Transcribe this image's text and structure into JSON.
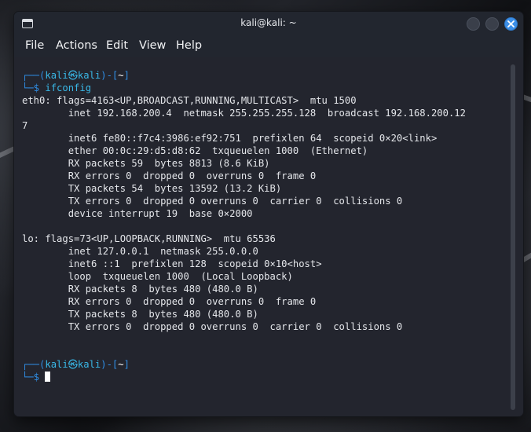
{
  "window": {
    "title": "kali@kali: ~"
  },
  "menu": {
    "items": [
      "File",
      "Actions",
      "Edit",
      "View",
      "Help"
    ]
  },
  "icons": {
    "app": "terminal-icon",
    "minimize": "minimize-icon",
    "maximize": "maximize-icon",
    "close": "close-icon"
  },
  "colors": {
    "prompt_frame": "#2f8de4",
    "prompt_user": "#39b7e6",
    "close_button": "#3c8fe8",
    "background": "#23252e"
  },
  "prompt": {
    "frame_open": "┌──(",
    "user": "kali㉿kali",
    "frame_mid": ")-[",
    "dir": "~",
    "frame_close": "]",
    "second_line": "└─$ "
  },
  "commands": {
    "first": "ifconfig"
  },
  "output": [
    "eth0: flags=4163<UP,BROADCAST,RUNNING,MULTICAST>  mtu 1500",
    "        inet 192.168.200.4  netmask 255.255.255.128  broadcast 192.168.200.12",
    "7",
    "        inet6 fe80::f7c4:3986:ef92:751  prefixlen 64  scopeid 0×20<link>",
    "        ether 00:0c:29:d5:d8:62  txqueuelen 1000  (Ethernet)",
    "        RX packets 59  bytes 8813 (8.6 KiB)",
    "        RX errors 0  dropped 0  overruns 0  frame 0",
    "        TX packets 54  bytes 13592 (13.2 KiB)",
    "        TX errors 0  dropped 0 overruns 0  carrier 0  collisions 0",
    "        device interrupt 19  base 0×2000",
    "",
    "lo: flags=73<UP,LOOPBACK,RUNNING>  mtu 65536",
    "        inet 127.0.0.1  netmask 255.0.0.0",
    "        inet6 ::1  prefixlen 128  scopeid 0×10<host>",
    "        loop  txqueuelen 1000  (Local Loopback)",
    "        RX packets 8  bytes 480 (480.0 B)",
    "        RX errors 0  dropped 0  overruns 0  frame 0",
    "        TX packets 8  bytes 480 (480.0 B)",
    "        TX errors 0  dropped 0 overruns 0  carrier 0  collisions 0"
  ]
}
